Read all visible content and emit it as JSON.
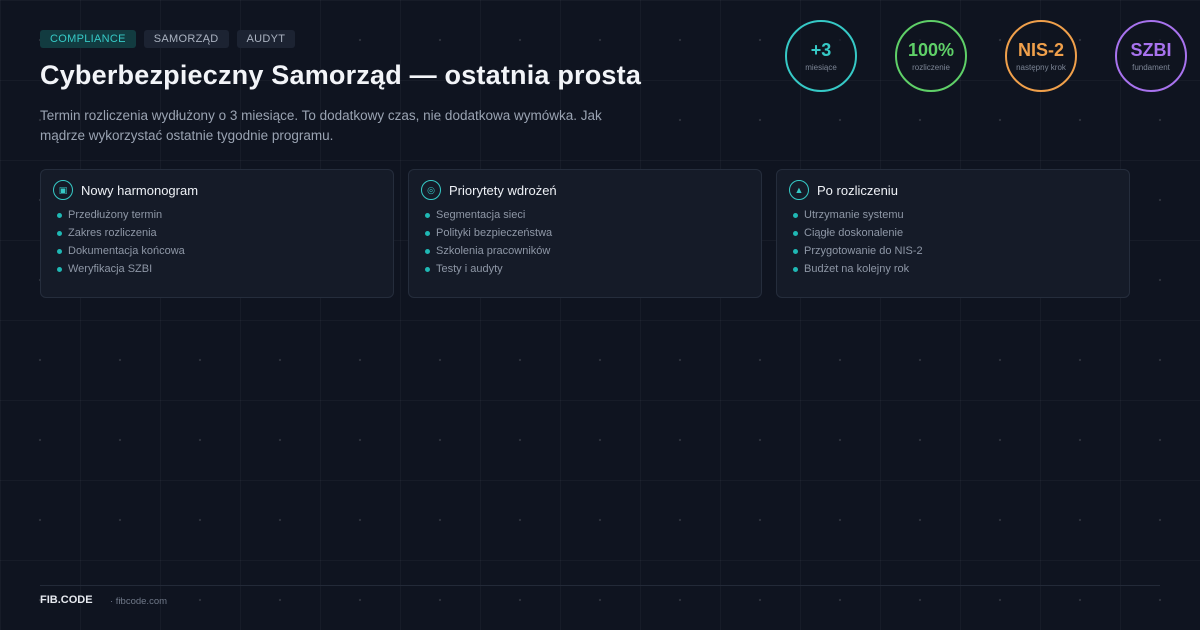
{
  "tags": [
    "COMPLIANCE",
    "SAMORZĄD",
    "AUDYT"
  ],
  "title": "Cyberbezpieczny Samorząd — ostatnia prosta",
  "subtitle": "Termin rozliczenia wydłużony o 3 miesiące. To dodatkowy czas, nie dodatkowa wymówka. Jak mądrze wykorzystać ostatnie tygodnie programu.",
  "stats": [
    {
      "value": "+3",
      "label": "miesiące",
      "color": "#36c9c6"
    },
    {
      "value": "100%",
      "label": "rozliczenie",
      "color": "#5fd068"
    },
    {
      "value": "NIS-2",
      "label": "następny krok",
      "color": "#f0a04b"
    },
    {
      "value": "SZBI",
      "label": "fundament",
      "color": "#a873ee"
    }
  ],
  "cards": [
    {
      "title": "Nowy harmonogram",
      "icon": "calendar-icon",
      "items": [
        "Przedłużony termin",
        "Zakres rozliczenia",
        "Dokumentacja końcowa",
        "Weryfikacja SZBI"
      ]
    },
    {
      "title": "Priorytety wdrożeń",
      "icon": "target-icon",
      "items": [
        "Segmentacja sieci",
        "Polityki bezpieczeństwa",
        "Szkolenia pracowników",
        "Testy i audyty"
      ]
    },
    {
      "title": "Po rozliczeniu",
      "icon": "rocket-icon",
      "items": [
        "Utrzymanie systemu",
        "Ciągłe doskonalenie",
        "Przygotowanie do NIS-2",
        "Budżet na kolejny rok"
      ]
    }
  ],
  "footer": {
    "brand": "FIB.CODE",
    "site": "· fibcode.com"
  }
}
